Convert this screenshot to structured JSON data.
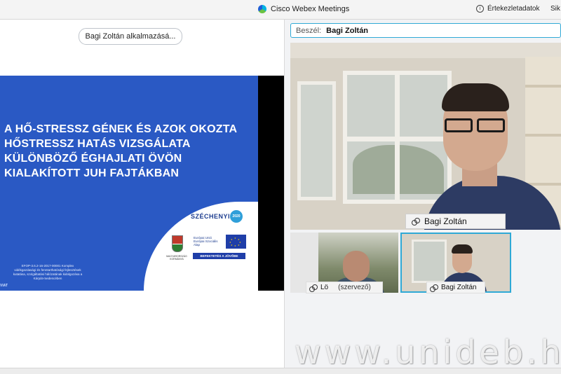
{
  "titlebar": {
    "app_name": "Cisco Webex Meetings",
    "meeting_info": "Értekezletadatok",
    "help_label": "Sik"
  },
  "share": {
    "chip_label": "Bagi Zoltán alkalmazásá..."
  },
  "slide": {
    "title_lines": [
      "A HŐ-STRESSZ GÉNEK ÉS AZOK OKOZTA",
      "HŐSTRESSZ HATÁS VIZSGÁLATA",
      "KÜLÖNBÖZŐ ÉGHAJLATI ÖVÖN",
      "KIALAKÍTOTT JUH FAJTÁKBAN"
    ],
    "szechenyi": "SZÉCHENYI",
    "badge": "2020",
    "kormany": "MAGYARORSZÁG KORMÁNYA",
    "eu_lines": [
      "Európai Unió",
      "Európai Szociális",
      "Alap"
    ],
    "befektetes": "BEFEKTETÉS A JÖVŐBE",
    "efop_lines": [
      "EFOP-3.6.2-16-2017-00001 Komplex",
      "vidékgazdasági és fenntarthatósági fejlesztések",
      "kutatása, szolgáltatási hálózatának kidolgozása a",
      "Kárpát-medencében"
    ],
    "footer_logo": "VIAT"
  },
  "speaker": {
    "label": "Beszél:",
    "name": "Bagi Zoltán"
  },
  "main_video": {
    "name": "Bagi Zoltán"
  },
  "thumbnails": [
    {
      "name": "Lö",
      "role": "(szervező)"
    },
    {
      "name": "Bagi Zoltán"
    }
  ],
  "watermark": "www.unideb.hu",
  "colors": {
    "slide_blue": "#2a59c4",
    "active_border": "#2fa9d6"
  }
}
